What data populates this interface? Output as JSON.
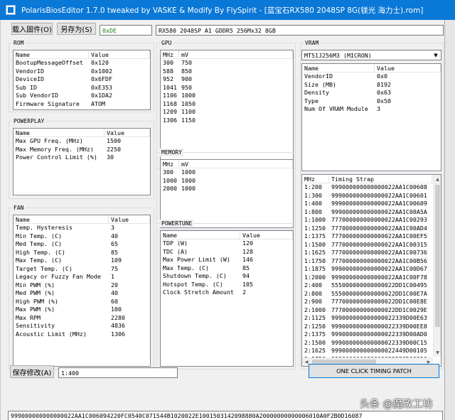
{
  "window": {
    "title": "PolarisBiosEditor 1.7.0 tweaked by VASKE & Modify By FlySpirit - [蓝宝石RX580 2048SP 8G(镁光 海力士).rom]"
  },
  "toolbar": {
    "load_label": "载入固件(O)",
    "save_as_label": "另存为(S)",
    "id_value": "0xDE",
    "desc_value": "RX580 2048SP A1 GDDR5 256Mx32 8GB"
  },
  "rom": {
    "title": "ROM",
    "headers": [
      "Name",
      "Value"
    ],
    "rows": [
      [
        "BootupMessageOffset",
        "0x120"
      ],
      [
        "VendorID",
        "0x1002"
      ],
      [
        "DeviceID",
        "0x6FDF"
      ],
      [
        "Sub ID",
        "0xE353"
      ],
      [
        "Sub VendorID",
        "0x1DA2"
      ],
      [
        "Firmware Signature",
        "ATOM"
      ]
    ]
  },
  "powerplay": {
    "title": "POWERPLAY",
    "headers": [
      "Name",
      "Value"
    ],
    "rows": [
      [
        "Max GPU Freq. (MHz)",
        "1500"
      ],
      [
        "Max Memory Freq. (MHz)",
        "2250"
      ],
      [
        "Power Control Limit (%)",
        "30"
      ]
    ]
  },
  "fan": {
    "title": "FAN",
    "headers": [
      "Name",
      "Value"
    ],
    "rows": [
      [
        "Temp. Hysteresis",
        "3"
      ],
      [
        "Min Temp. (C)",
        "40"
      ],
      [
        "Med Temp. (C)",
        "65"
      ],
      [
        "High Temp. (C)",
        "85"
      ],
      [
        "Max Temp. (C)",
        "109"
      ],
      [
        "Target Temp. (C)",
        "75"
      ],
      [
        "Legacy or Fuzzy Fan Mode",
        "1"
      ],
      [
        "Min PWM (%)",
        "20"
      ],
      [
        "Med PWM (%)",
        "40"
      ],
      [
        "High PWM (%)",
        "60"
      ],
      [
        "Max PWM (%)",
        "100"
      ],
      [
        "Max RPM",
        "2280"
      ],
      [
        "Sensitivity",
        "4836"
      ],
      [
        "Acoustic Limit (MHz)",
        "1306"
      ]
    ]
  },
  "gpu": {
    "title": "GPU",
    "headers": [
      "MHz",
      "mV"
    ],
    "rows": [
      [
        "300",
        "750"
      ],
      [
        "588",
        "850"
      ],
      [
        "952",
        "900"
      ],
      [
        "1041",
        "950"
      ],
      [
        "1106",
        "1000"
      ],
      [
        "1168",
        "1050"
      ],
      [
        "1209",
        "1100"
      ],
      [
        "1306",
        "1150"
      ]
    ]
  },
  "memory": {
    "title": "MEMORY",
    "headers": [
      "MHz",
      "mV"
    ],
    "rows": [
      [
        "300",
        "1000"
      ],
      [
        "1000",
        "1000"
      ],
      [
        "2000",
        "1000"
      ]
    ]
  },
  "powertune": {
    "title": "POWERTUNE",
    "headers": [
      "Name",
      "Value"
    ],
    "rows": [
      [
        "TDP (W)",
        "120"
      ],
      [
        "TDC (A)",
        "128"
      ],
      [
        "Max Power Limit (W)",
        "146"
      ],
      [
        "Max Temp. (C)",
        "85"
      ],
      [
        "Shutdown Temp. (C)",
        "94"
      ],
      [
        "Hotspot Temp. (C)",
        "105"
      ],
      [
        "Clock Stretch Amount",
        "2"
      ]
    ]
  },
  "vram": {
    "title": "VRAM",
    "selected_chip": "MT51J256M3 (MICRON)",
    "headers": [
      "Name",
      "Value"
    ],
    "rows": [
      [
        "VendorID",
        "0x0"
      ],
      [
        "Size (MB)",
        "8192"
      ],
      [
        "Density",
        "0x63"
      ],
      [
        "Type",
        "0x50"
      ],
      [
        "Num Of VRAM Module",
        "3"
      ]
    ]
  },
  "timing": {
    "headers": [
      "MHz",
      "Timing Strap"
    ],
    "rows": [
      [
        "1:200",
        "999000000000000022AA1C00608"
      ],
      [
        "1:300",
        "999000000000000022AA1C00601"
      ],
      [
        "1:400",
        "999000000000000022AA1C00609"
      ],
      [
        "1:800",
        "999000000000000022AA1C00A5A"
      ],
      [
        "1:1000",
        "777000000000000022AA1C00293"
      ],
      [
        "1:1250",
        "777000000000000022AA1C00AD4"
      ],
      [
        "1:1375",
        "777000000000000022AA1C00EF5"
      ],
      [
        "1:1500",
        "777000000000000022AA1C00315"
      ],
      [
        "1:1625",
        "777000000000000022AA1C00736"
      ],
      [
        "1:1750",
        "777000000000000022AA1C00B56"
      ],
      [
        "1:1875",
        "999000000000000022AA1C00D67"
      ],
      [
        "1:2000",
        "999000000000000022AA1C00F78"
      ],
      [
        "2:400",
        "555000000000000022DD1C00495"
      ],
      [
        "2:800",
        "555000000000000022DD1C00E7A"
      ],
      [
        "2:900",
        "777000000000000022DD1C00E8E"
      ],
      [
        "2:1000",
        "777000000000000022DD1C0029E"
      ],
      [
        "2:1125",
        "999000000000000022339D00E63"
      ],
      [
        "2:1250",
        "999000000000000022339D00EE8"
      ],
      [
        "2:1375",
        "999000000000000022339D00AD0"
      ],
      [
        "2:1500",
        "999000000000000022339D00C15"
      ],
      [
        "2:1625",
        "999000000000000022449D00105"
      ],
      [
        "2:1750",
        "999000000000000022559D00316"
      ]
    ]
  },
  "bottom": {
    "save_mod_label": "保存修改(A)",
    "strap_field_value": "1:400",
    "one_click_label": "ONE CLICK TIMING PATCH",
    "status_text": "999000000000000022AA1C006094220FC0540C071544B1020022E1001503142098880A20000000000006010A0F2B0D16087",
    "watermark": "头条 @魔改工坊"
  }
}
